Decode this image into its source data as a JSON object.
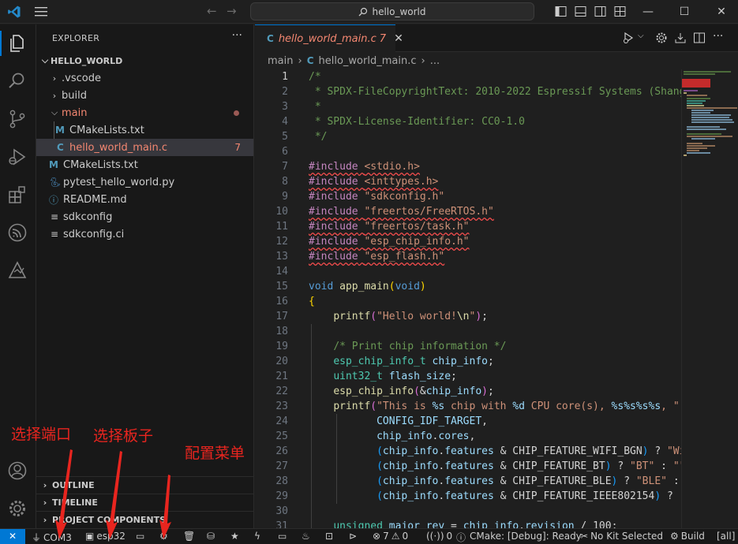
{
  "titlebar": {
    "search_text": "hello_world",
    "icons": [
      "vscode-logo",
      "menu-icon",
      "back-arrow-icon",
      "forward-arrow-icon",
      "search-icon",
      "toggle-primary-sidebar-icon",
      "toggle-panel-icon",
      "toggle-secondary-sidebar-icon",
      "customize-layout-icon"
    ],
    "window_controls": {
      "minimize": "—",
      "maximize": "☐",
      "close": "✕"
    }
  },
  "activitybar": {
    "items": [
      "explorer-icon",
      "search-icon",
      "source-control-icon",
      "run-debug-icon",
      "extensions-icon",
      "espressif-icon",
      "idf-explorer-icon"
    ],
    "bottom": [
      "accounts-icon",
      "manage-gear-icon"
    ]
  },
  "sidebar": {
    "title": "EXPLORER",
    "more": "···",
    "root": "HELLO_WORLD",
    "tree": [
      {
        "label": ".vscode",
        "type": "folder",
        "state": "collapsed",
        "depth": 1
      },
      {
        "label": "build",
        "type": "folder",
        "state": "collapsed",
        "depth": 1
      },
      {
        "label": "main",
        "type": "folder",
        "state": "expanded",
        "depth": 1
      },
      {
        "label": "CMakeLists.txt",
        "type": "cmake",
        "depth": 2
      },
      {
        "label": "hello_world_main.c",
        "type": "c",
        "depth": 2,
        "badge": "7"
      },
      {
        "label": "CMakeLists.txt",
        "type": "cmake",
        "depth": 1
      },
      {
        "label": "pytest_hello_world.py",
        "type": "python",
        "depth": 1
      },
      {
        "label": "README.md",
        "type": "info",
        "depth": 1
      },
      {
        "label": "sdkconfig",
        "type": "config",
        "depth": 1
      },
      {
        "label": "sdkconfig.ci",
        "type": "config",
        "depth": 1
      }
    ],
    "sections": [
      "OUTLINE",
      "TIMELINE",
      "PROJECT COMPONENTS"
    ]
  },
  "editor": {
    "tab": {
      "icon": "C",
      "name": "hello_world_main.c",
      "problems": "7",
      "close": "✕"
    },
    "breadcrumb": {
      "folder": "main",
      "file_icon": "C",
      "file": "hello_world_main.c",
      "more": "..."
    },
    "current_line": 1,
    "line_numbers": [
      "1",
      "2",
      "3",
      "4",
      "5",
      "6",
      "7",
      "8",
      "9",
      "10",
      "11",
      "12",
      "13",
      "14",
      "15",
      "16",
      "17",
      "18",
      "19",
      "20",
      "21",
      "22",
      "23",
      "24",
      "25",
      "26",
      "27",
      "28",
      "29",
      "30",
      "31"
    ]
  },
  "statusbar": {
    "remote": "✕",
    "port": "COM3",
    "target": "esp32",
    "errors": "7",
    "warnings": "0",
    "broadcast": "0",
    "cmake": "CMake: [Debug]: Ready",
    "kit": "No Kit Selected",
    "build": "Build",
    "all": "[all]"
  },
  "annotations": {
    "select_port": "选择端口",
    "select_board": "选择板子",
    "config_menu": "配置菜单"
  },
  "colors": {
    "accent": "#0078d4",
    "error": "#f48771",
    "annotation": "#e8251f"
  }
}
